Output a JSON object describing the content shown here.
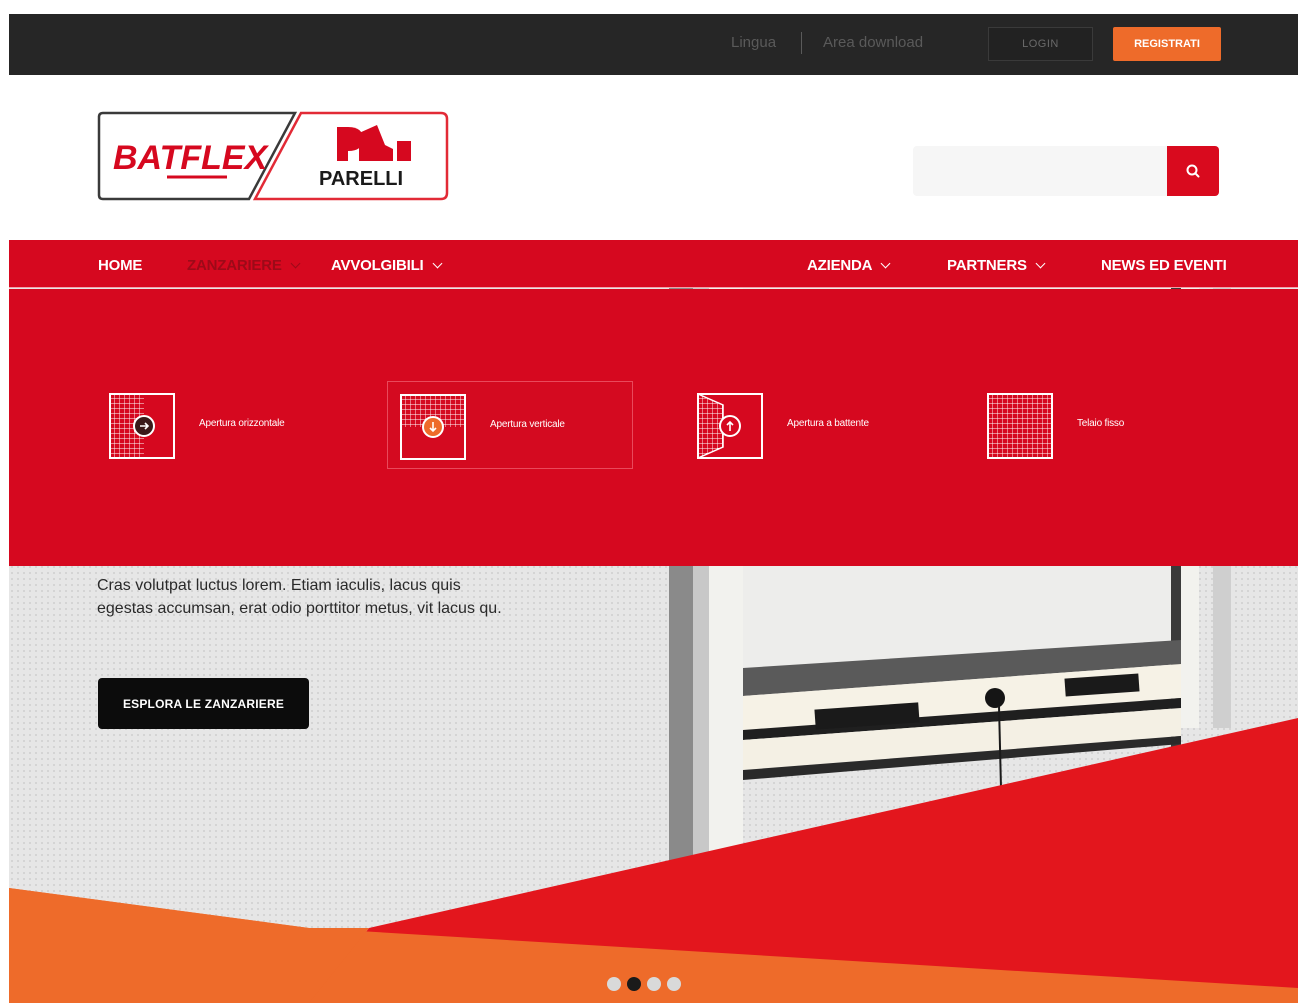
{
  "topbar": {
    "language": "Lingua",
    "download_area": "Area download",
    "login": "LOGIN",
    "register": "REGISTRATI"
  },
  "header": {
    "logo_batflex": "BATFLEX",
    "logo_parelli": "PARELLI",
    "search_placeholder": "",
    "search_icon": "search-icon"
  },
  "nav": {
    "items": [
      {
        "label": "HOME",
        "active": false
      },
      {
        "label": "ZANZARIERE",
        "active": true
      },
      {
        "label": "AVVOLGIBILI",
        "active": false
      },
      {
        "label": "AZIENDA",
        "active": false
      },
      {
        "label": "PARTNERS",
        "active": false
      },
      {
        "label": "NEWS ED EVENTI",
        "active": false
      }
    ]
  },
  "dropdown": {
    "cards": [
      {
        "label": "Apertura orizzontale",
        "icon": "horizontal-opening-icon"
      },
      {
        "label": "Apertura verticale",
        "icon": "vertical-opening-icon"
      },
      {
        "label": "Apertura a battente",
        "icon": "hinged-opening-icon"
      },
      {
        "label": "Telaio fisso",
        "icon": "fixed-frame-icon"
      }
    ]
  },
  "hero": {
    "text_line1": "Cras volutpat luctus lorem. Etiam iaculis, lacus quis",
    "text_line2": "egestas accumsan, erat odio porttitor metus, vit lacus qu.",
    "cta": "ESPLORA LE ZANZARIERE"
  },
  "carousel": {
    "slide_count": 4,
    "active_index": 1
  },
  "colors": {
    "brand_red": "#d6081f",
    "accent_orange": "#ee6b2a",
    "topbar_bg": "#262626"
  }
}
